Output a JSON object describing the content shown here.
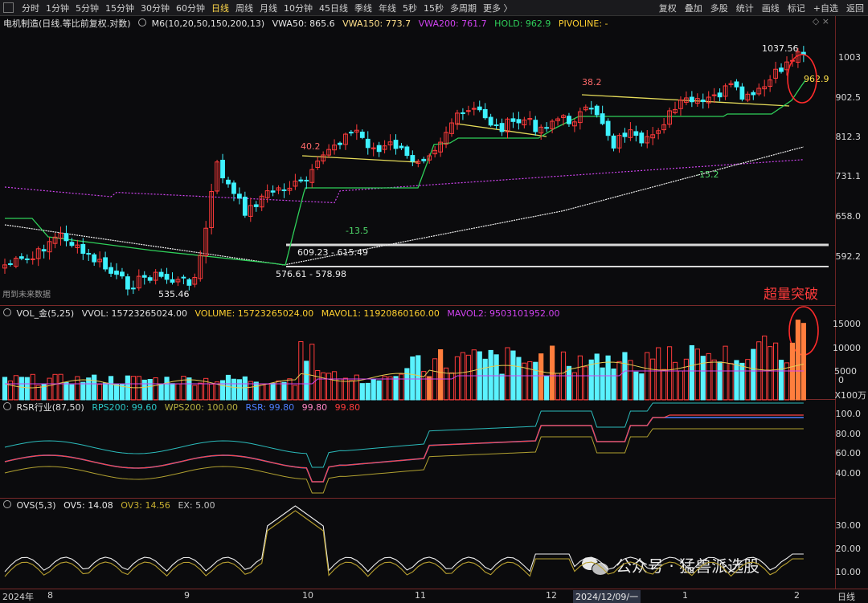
{
  "toolbar": {
    "timeframes": [
      "分时",
      "1分钟",
      "5分钟",
      "15分钟",
      "30分钟",
      "60分钟",
      "日线",
      "周线",
      "月线",
      "10分钟",
      "45日线",
      "季线",
      "年线",
      "5秒",
      "15秒",
      "多周期",
      "更多 〉"
    ],
    "active": "日线",
    "tools": [
      "复权",
      "叠加",
      "多股",
      "统计",
      "画线",
      "标记",
      "+自选",
      "返回"
    ]
  },
  "main": {
    "stock": "电机制造(日线.等比前复权.对数)",
    "ma": "M6(10,20,50,150,200,13)",
    "vwa50": "VWA50: 865.6",
    "vwa150": "VWA150: 773.7",
    "vwa200": "VWA200: 761.7",
    "hold": "HOLD: 962.9",
    "pivoline": "PIVOLINE: -",
    "note": "用到未来数据",
    "breakout": "超量突破",
    "ticks": [
      "1003",
      "902.5",
      "812.3",
      "731.1",
      "658.0",
      "592.2"
    ],
    "ann": {
      "high": "1037.56",
      "hold": "962.9",
      "a402": "40.2",
      "a382": "38.2",
      "m135": "-13.5",
      "m152": "-15.2",
      "low": "535.46",
      "r1": "609.23 - 615.49",
      "r2": "576.61 - 578.98"
    }
  },
  "vol": {
    "name": "VOL_金(5,25)",
    "vvol": "VVOL: 15723265024.00",
    "volume": "VOLUME: 15723265024.00",
    "mavol1": "MAVOL1: 11920860160.00",
    "mavol2": "MAVOL2: 9503101952.00",
    "ticks": [
      "15000",
      "10000",
      "5000",
      "0"
    ],
    "unit": "X100万"
  },
  "rsr": {
    "name": "RSR行业(87,50)",
    "rps": "RPS200: 99.60",
    "wps": "WPS200: 100.00",
    "rsr": "RSR: 99.80",
    "val": "99.80",
    "ticks": [
      "100.0",
      "80.00",
      "60.00",
      "40.00"
    ]
  },
  "ovs": {
    "name": "OVS(5,3)",
    "ov5": "OV5: 14.08",
    "ov3": "OV3: 14.56",
    "ex": "EX: 5.00",
    "ticks": [
      "30.00",
      "20.00",
      "10.00"
    ]
  },
  "xaxis": {
    "year": "2024年",
    "labels": [
      "8",
      "9",
      "10",
      "11",
      "12",
      "1",
      "2"
    ],
    "cursor": "2024/12/09/一",
    "right": "日线"
  },
  "watermark": "公众号 · 猛兽派选股",
  "colors": {
    "up": "#ff3b3b",
    "down": "#3ef2ff",
    "yellow": "#e8e070",
    "purple": "#d043f0",
    "green": "#2fd05a",
    "orange": "#ff7e3d"
  }
}
